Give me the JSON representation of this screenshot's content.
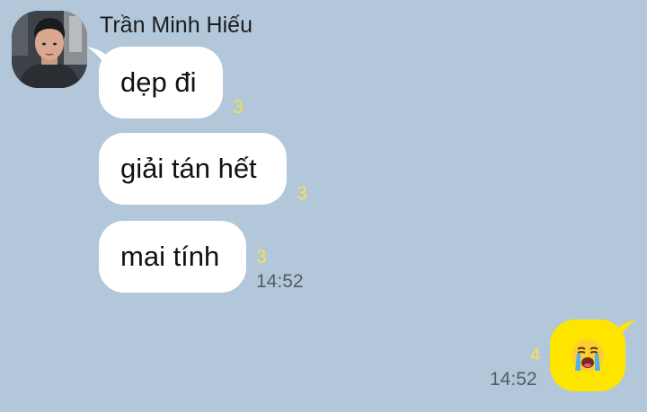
{
  "chat": {
    "sender": {
      "name": "Trần Minh Hiếu"
    },
    "incoming_messages": [
      {
        "text": "dẹp đi",
        "unread": "3"
      },
      {
        "text": "giải tán hết",
        "unread": "3"
      },
      {
        "text": "mai tính",
        "unread": "3",
        "time": "14:52"
      }
    ],
    "outgoing_messages": [
      {
        "content": "loudly-crying-face-emoji",
        "unread": "4",
        "time": "14:52"
      }
    ]
  },
  "colors": {
    "background": "#b2c7d9",
    "incoming_bubble": "#ffffff",
    "outgoing_bubble": "#fee500",
    "unread_count": "#f5e34a",
    "timestamp": "#555c64"
  }
}
